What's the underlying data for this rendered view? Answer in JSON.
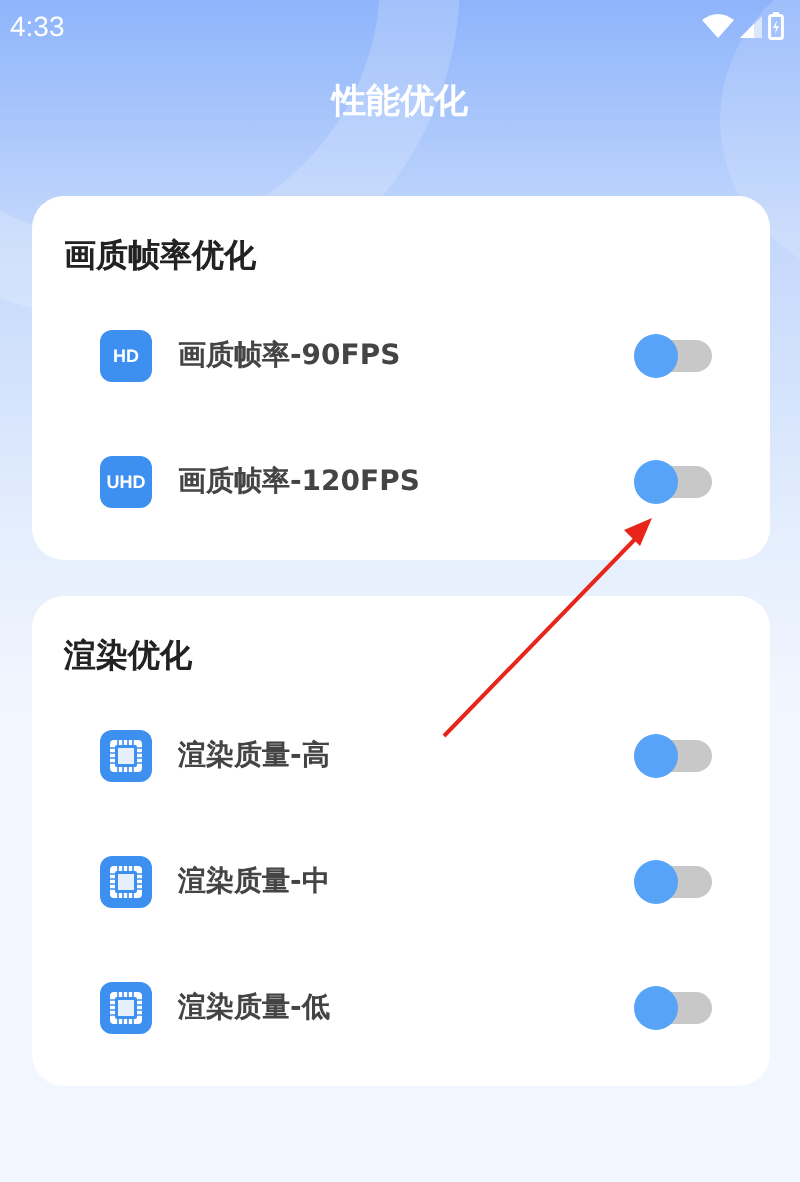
{
  "status_bar": {
    "time": "4:33"
  },
  "header": {
    "title": "性能优化"
  },
  "sections": [
    {
      "title": "画质帧率优化",
      "items": [
        {
          "kind": "badge",
          "badge": "HD",
          "label": "画质帧率-90FPS",
          "on": false
        },
        {
          "kind": "badge",
          "badge": "UHD",
          "label": "画质帧率-120FPS",
          "on": false
        }
      ]
    },
    {
      "title": "渲染优化",
      "items": [
        {
          "kind": "chip",
          "label": "渲染质量-高",
          "on": false
        },
        {
          "kind": "chip",
          "label": "渲染质量-中",
          "on": false
        },
        {
          "kind": "chip",
          "label": "渲染质量-低",
          "on": false
        }
      ]
    }
  ]
}
